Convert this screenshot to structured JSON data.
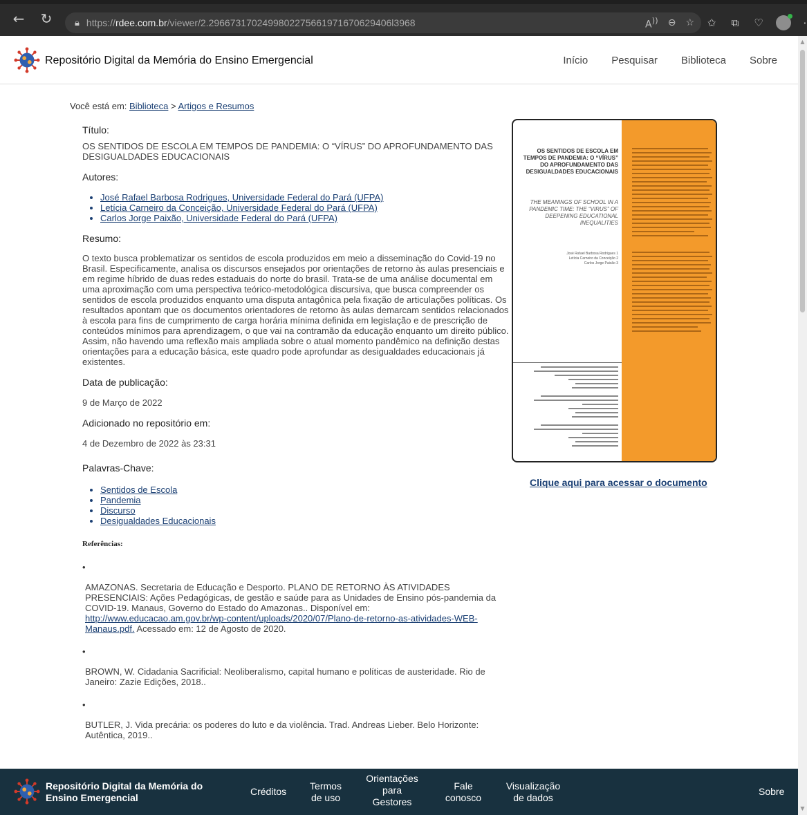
{
  "browser": {
    "url_prefix": "https://",
    "url_domain": "rdee.com.br",
    "url_path": "/viewer/2.2966731702499802275661971670629406l3968"
  },
  "header": {
    "site_title": "Repositório Digital da Memória do Ensino Emergencial",
    "nav": [
      "Início",
      "Pesquisar",
      "Biblioteca",
      "Sobre"
    ]
  },
  "breadcrumb": {
    "prefix": "Você está em:",
    "level1": "Biblioteca",
    "separator": ">",
    "level2": "Artigos e Resumos"
  },
  "article": {
    "title_label": "Título:",
    "title": "OS SENTIDOS DE ESCOLA EM TEMPOS DE PANDEMIA: O “VÍRUS” DO APROFUNDAMENTO DAS DESIGUALDADES EDUCACIONAIS",
    "authors_label": "Autores:",
    "authors": [
      "José Rafael Barbosa Rodrigues, Universidade Federal do Pará (UFPA)",
      "Letícia Carneiro da Conceição, Universidade Federal do Pará (UFPA)",
      "Carlos Jorge Paixão, Universidade Federal do Pará (UFPA)"
    ],
    "abstract_label": "Resumo:",
    "abstract": "O texto busca problematizar os sentidos de escola produzidos em meio a disseminação do Covid-19 no Brasil. Especificamente, analisa os discursos ensejados por orientações de retorno às aulas presenciais e em regime híbrido de duas redes estaduais do norte do brasil. Trata-se de uma análise documental em uma aproximação com uma perspectiva teórico-metodológica discursiva, que busca compreender os sentidos de escola produzidos enquanto uma disputa antagônica pela fixação de articulações políticas. Os resultados apontam que os documentos orientadores de retorno às aulas demarcam sentidos relacionados à escola para fins de cumprimento de carga horária mínima definida em legislação e de prescrição de conteúdos mínimos para aprendizagem, o que vai na contramão da educação enquanto um direito público. Assim, não havendo uma reflexão mais ampliada sobre o atual momento pandêmico na definição destas orientações para a educação básica, este quadro pode aprofundar as desigualdades educacionais já existentes.",
    "pub_date_label": "Data de publicação:",
    "pub_date": "9 de Março de 2022",
    "added_label": "Adicionado no repositório em:",
    "added_date": "4 de Dezembro de 2022 às 23:31",
    "keywords_label": "Palavras-Chave:",
    "keywords": [
      "Sentidos de Escola",
      "Pandemia",
      "Discurso",
      "Desigualdades Educacionais"
    ],
    "references_label": "Referências:",
    "references": [
      {
        "text_before": "AMAZONAS. Secretaria de Educação e Desporto. PLANO DE RETORNO ÀS ATIVIDADES PRESENCIAIS: Ações Pedagógicas, de gestão e saúde para as Unidades de Ensino pós-pandemia da COVID-19. Manaus, Governo do Estado do Amazonas.. Disponível em: ",
        "link": "http://www.educacao.am.gov.br/wp-content/uploads/2020/07/Plano-de-retorno-as-atividades-WEB-Manaus.pdf.",
        "text_after": " Acessado em: 12 de Agosto de 2020."
      },
      {
        "text_before": "BROWN, W. Cidadania Sacrificial: Neoliberalismo, capital humano e políticas de austeridade. Rio de Janeiro: Zazie Edições, 2018..",
        "link": "",
        "text_after": ""
      },
      {
        "text_before": "BUTLER, J. Vida precária: os poderes do luto e da violência. Trad. Andreas Lieber. Belo Horizonte: Autêntica, 2019..",
        "link": "",
        "text_after": ""
      }
    ]
  },
  "document_preview": {
    "title": "OS SENTIDOS DE ESCOLA EM TEMPOS DE PANDEMIA: O “VÍRUS” DO APROFUNDAMENTO DAS DESIGUALDADES EDUCACIONAIS",
    "subtitle": "THE MEANINGS OF SCHOOL IN A PANDEMIC TIME: THE “VIRUS” OF DEEPENING EDUCATIONAL INEQUALITIES",
    "authors_lines": [
      "José Rafael Barbosa Rodrigues 1",
      "Letícia Carneiro da Conceição 2",
      "Carlos Jorge Paixão 3"
    ],
    "access_link": "Clique aqui para acessar o documento",
    "accent_color": "#f39a2b"
  },
  "footer": {
    "title": "Repositório Digital da Memória do Ensino Emergencial",
    "creditos": "Créditos",
    "termos": [
      "Termos",
      "de uso"
    ],
    "orientacoes": [
      "Orientações",
      "para",
      "Gestores"
    ],
    "fale": [
      "Fale",
      "conosco"
    ],
    "visualizacao": [
      "Visualização",
      "de dados"
    ],
    "sobre": "Sobre",
    "bg_color": "#18313f"
  }
}
